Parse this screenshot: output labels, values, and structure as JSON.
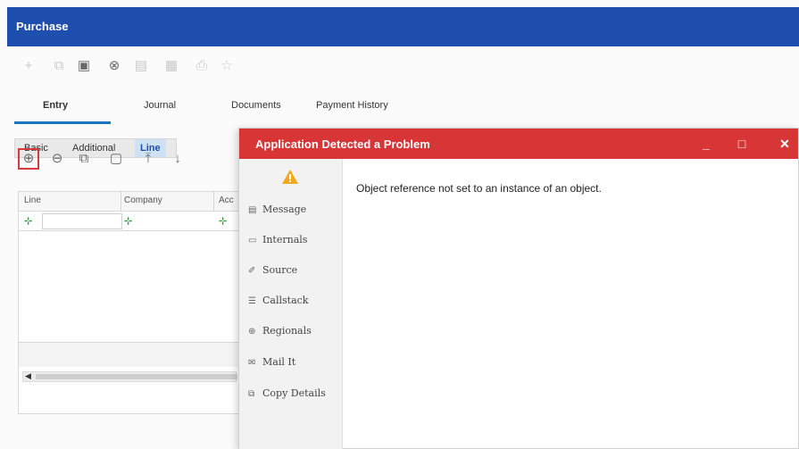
{
  "window": {
    "title": "Purchase"
  },
  "toolbar_icons": [
    "plus-icon",
    "copy-icon",
    "save-icon",
    "cancel-icon",
    "delete-icon",
    "document-icon",
    "print-icon",
    "pin-icon"
  ],
  "top_tabs": [
    {
      "label": "Entry",
      "active": true
    },
    {
      "label": "Journal",
      "active": false
    },
    {
      "label": "Documents",
      "active": false
    },
    {
      "label": "Payment History",
      "active": false
    }
  ],
  "sub_tabs": [
    {
      "label": "Basic",
      "active": false
    },
    {
      "label": "Additional",
      "active": false
    },
    {
      "label": "Line",
      "active": true
    }
  ],
  "grid_toolbar_icons": [
    "add-row-icon",
    "remove-row-icon",
    "copy-row-icon",
    "paste-row-icon",
    "move-top-icon",
    "move-down-icon"
  ],
  "grid": {
    "columns": [
      "Line",
      "Company",
      "Acc"
    ]
  },
  "dialog": {
    "title": "Application Detected a Problem",
    "message": "Object reference not set to an instance of an object.",
    "controls": {
      "minimize": "_",
      "maximize": "□",
      "close": "✕"
    },
    "side_items": [
      {
        "label": "Message",
        "icon": "message-icon"
      },
      {
        "label": "Internals",
        "icon": "internals-icon"
      },
      {
        "label": "Source",
        "icon": "source-icon"
      },
      {
        "label": "Callstack",
        "icon": "callstack-icon"
      },
      {
        "label": "Regionals",
        "icon": "globe-icon"
      },
      {
        "label": "Mail It",
        "icon": "mail-icon"
      },
      {
        "label": "Copy Details",
        "icon": "copy-icon"
      }
    ]
  },
  "colors": {
    "app_bar": "#1e4fae",
    "dialog_bar": "#d83636",
    "highlight": "#d63a3a",
    "warning": "#f2a81d"
  }
}
